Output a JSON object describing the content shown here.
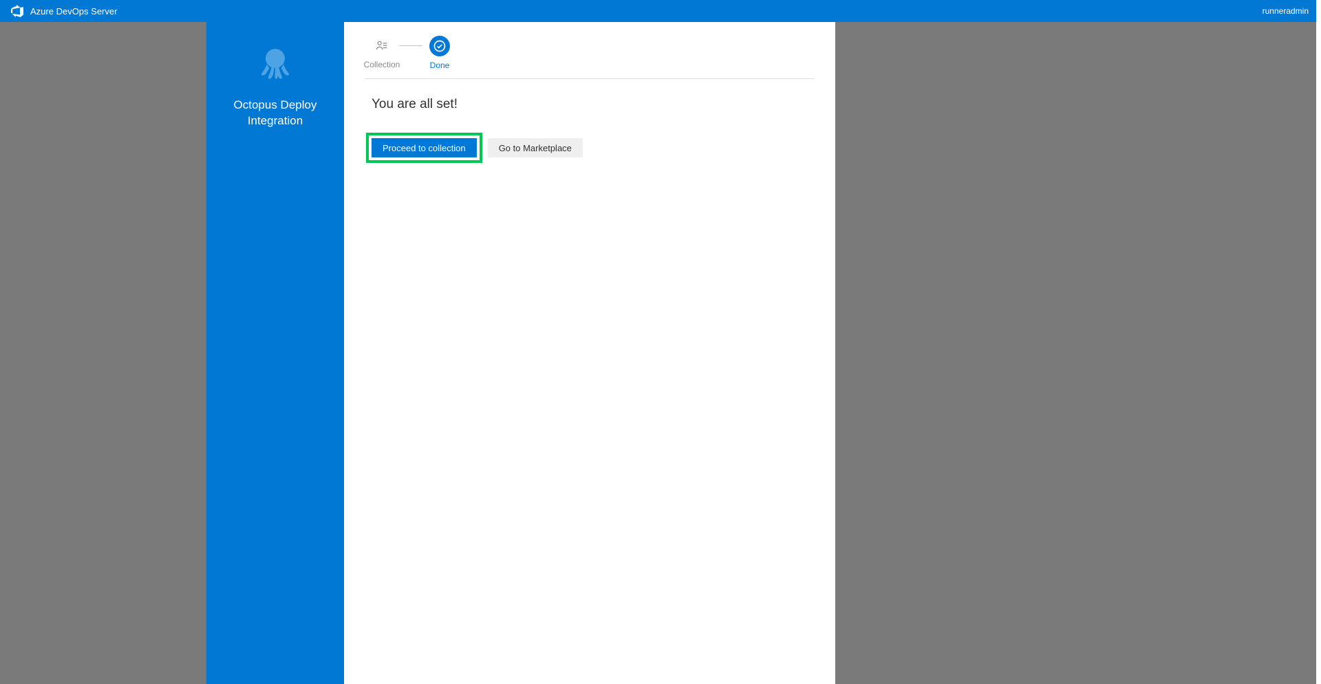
{
  "topbar": {
    "title": "Azure DevOps Server",
    "user": "runneradmin"
  },
  "sidebar": {
    "extension_name": "Octopus Deploy Integration"
  },
  "steps": {
    "collection_label": "Collection",
    "done_label": "Done"
  },
  "main": {
    "heading": "You are all set!",
    "primary_button": "Proceed to collection",
    "secondary_button": "Go to Marketplace"
  }
}
